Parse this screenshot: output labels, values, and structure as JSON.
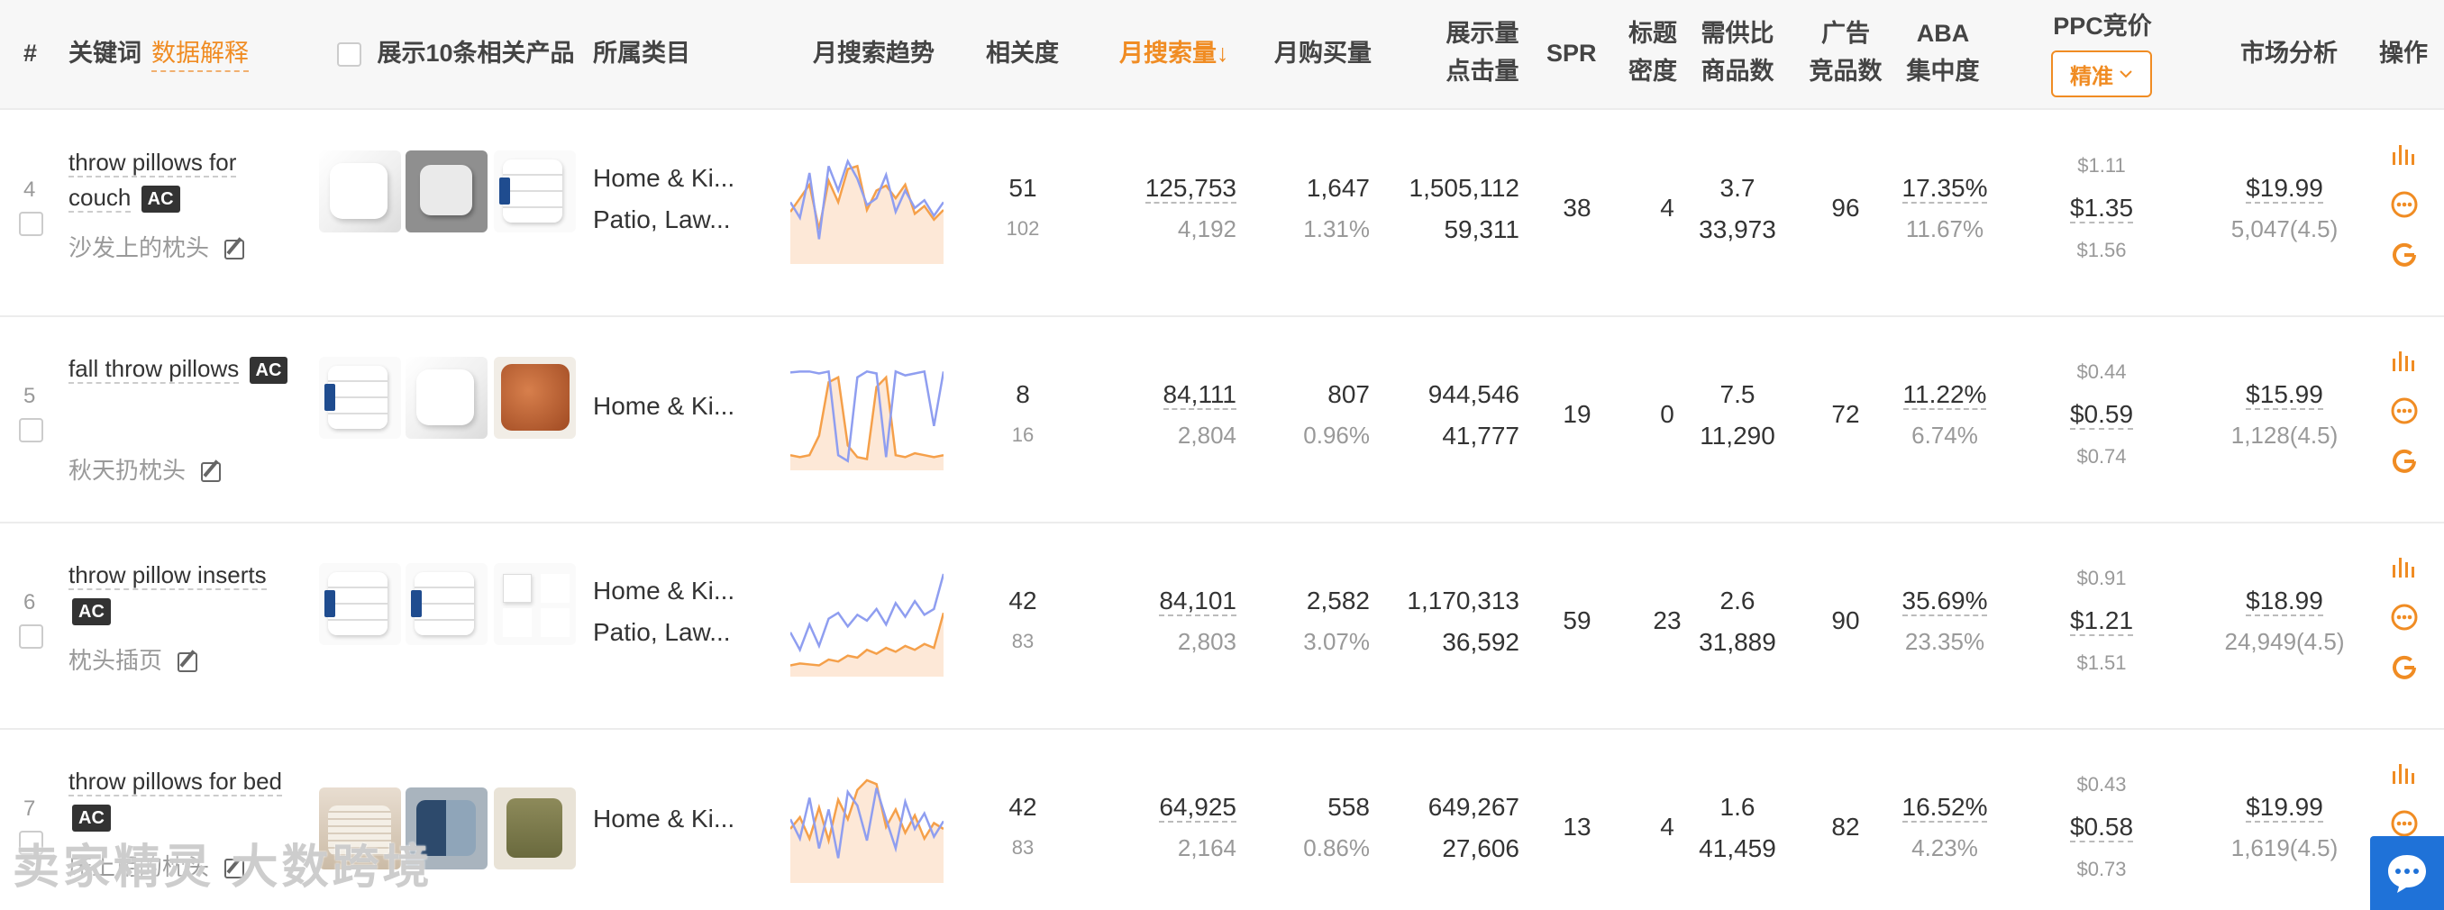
{
  "header": {
    "num": "#",
    "keyword": "关键词",
    "data_explain": "数据解释",
    "show_products": "展示10条相关产品",
    "category": "所属类目",
    "trend": "月搜索趋势",
    "relevance": "相关度",
    "monthly_search": "月搜索量",
    "sort_arrow": "↓",
    "monthly_purchase": "月购买量",
    "impressions": "展示量",
    "clicks": "点击量",
    "spr": "SPR",
    "title_label": "标题",
    "density_label": "密度",
    "supply_demand": "需供比",
    "product_count": "商品数",
    "ad_label": "广告",
    "ad_products": "竞品数",
    "aba": "ABA",
    "concentration": "集中度",
    "ppc": "PPC竞价",
    "ppc_mode": "精准",
    "market_analysis": "市场分析",
    "actions": "操作"
  },
  "rows": [
    {
      "index": "4",
      "keyword": "throw pillows for couch",
      "badge": "AC",
      "translation": "沙发上的枕头",
      "categories": [
        "Home & Ki...",
        "Patio, Law..."
      ],
      "relevance": "51",
      "relevance_sub": "102",
      "search_volume": "125,753",
      "search_sub": "4,192",
      "purchase": "1,647",
      "purchase_rate": "1.31%",
      "impressions": "1,505,112",
      "clicks": "59,311",
      "spr": "38",
      "title_density": "4",
      "supply_demand": "3.7",
      "products": "33,973",
      "ad_products": "96",
      "aba": "17.35%",
      "aba_sub": "11.67%",
      "ppc_low": "$1.11",
      "ppc_mid": "$1.35",
      "ppc_high": "$1.56",
      "price": "$19.99",
      "reviews": "5,047(4.5)",
      "trend_search": [
        58,
        42,
        88,
        20,
        95,
        70,
        100,
        82,
        55,
        62,
        86,
        48,
        70,
        52,
        60,
        44,
        58
      ],
      "trend_purchase": [
        48,
        62,
        76,
        30,
        80,
        58,
        92,
        95,
        50,
        70,
        75,
        62,
        76,
        46,
        54,
        40,
        50
      ]
    },
    {
      "index": "5",
      "keyword": "fall throw pillows",
      "badge": "AC",
      "translation": "秋天扔枕头",
      "categories": [
        "Home & Ki..."
      ],
      "relevance": "8",
      "relevance_sub": "16",
      "search_volume": "84,111",
      "search_sub": "2,804",
      "purchase": "807",
      "purchase_rate": "0.96%",
      "impressions": "944,546",
      "clicks": "41,777",
      "spr": "19",
      "title_density": "0",
      "supply_demand": "7.5",
      "products": "11,290",
      "ad_products": "72",
      "aba": "11.22%",
      "aba_sub": "6.74%",
      "ppc_low": "$0.44",
      "ppc_mid": "$0.59",
      "ppc_high": "$0.74",
      "price": "$15.99",
      "reviews": "1,128(4.5)",
      "trend_search": [
        95,
        96,
        96,
        94,
        96,
        10,
        4,
        90,
        96,
        94,
        8,
        96,
        92,
        94,
        96,
        40,
        96
      ],
      "trend_purchase": [
        10,
        8,
        10,
        30,
        85,
        90,
        20,
        8,
        6,
        80,
        90,
        10,
        8,
        12,
        10,
        8,
        10
      ]
    },
    {
      "index": "6",
      "keyword": "throw pillow inserts",
      "badge": "AC",
      "translation": "枕头插页",
      "categories": [
        "Home & Ki...",
        "Patio, Law..."
      ],
      "relevance": "42",
      "relevance_sub": "83",
      "search_volume": "84,101",
      "search_sub": "2,803",
      "purchase": "2,582",
      "purchase_rate": "3.07%",
      "impressions": "1,170,313",
      "clicks": "36,592",
      "spr": "59",
      "title_density": "23",
      "supply_demand": "2.6",
      "products": "31,889",
      "ad_products": "90",
      "aba": "35.69%",
      "aba_sub": "23.35%",
      "ppc_low": "$0.91",
      "ppc_mid": "$1.21",
      "ppc_high": "$1.51",
      "price": "$18.99",
      "reviews": "24,949(4.5)",
      "trend_search": [
        40,
        22,
        48,
        26,
        54,
        60,
        46,
        58,
        52,
        64,
        48,
        70,
        56,
        72,
        58,
        64,
        100
      ],
      "trend_purchase": [
        6,
        8,
        7,
        6,
        12,
        10,
        16,
        14,
        22,
        18,
        24,
        20,
        26,
        22,
        28,
        24,
        60
      ]
    },
    {
      "index": "7",
      "keyword": "throw pillows for bed",
      "badge": "AC",
      "translation": "床上用的枕头",
      "categories": [
        "Home & Ki..."
      ],
      "relevance": "42",
      "relevance_sub": "83",
      "search_volume": "64,925",
      "search_sub": "2,164",
      "purchase": "558",
      "purchase_rate": "0.86%",
      "impressions": "649,267",
      "clicks": "27,606",
      "spr": "13",
      "title_density": "4",
      "supply_demand": "1.6",
      "products": "41,459",
      "ad_products": "82",
      "aba": "16.52%",
      "aba_sub": "4.23%",
      "ppc_low": "$0.43",
      "ppc_mid": "$0.58",
      "ppc_high": "$0.73",
      "price": "$19.99",
      "reviews": "1,619(4.5)",
      "trend_search": [
        60,
        40,
        82,
        30,
        70,
        20,
        88,
        74,
        38,
        92,
        60,
        30,
        78,
        50,
        66,
        42,
        58
      ],
      "trend_purchase": [
        50,
        62,
        40,
        72,
        38,
        80,
        60,
        90,
        100,
        96,
        52,
        70,
        46,
        64,
        40,
        56,
        50
      ]
    }
  ],
  "colors": {
    "accent": "#f08c23",
    "trend_search_line": "#8f9ef0",
    "trend_purchase_line": "#f5a04a",
    "trend_fill": "#fde8d7",
    "op_chart": "#f08c23",
    "op_more": "#f08c23",
    "op_google": "#f08c23",
    "chat": "#1f72d8"
  },
  "watermark": "卖家精灵 大数跨境",
  "icons": [
    "bar-chart-icon",
    "more-icon",
    "google-icon",
    "chat-icon",
    "edit-icon",
    "chevron-down-icon"
  ]
}
